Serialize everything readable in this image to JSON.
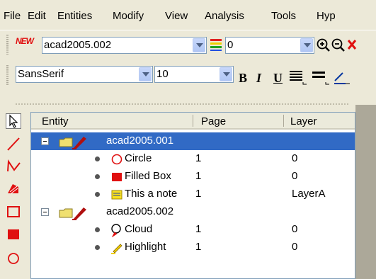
{
  "menu": {
    "items": [
      "File",
      "Edit",
      "Entities",
      "Modify",
      "View",
      "Analysis",
      "Tools",
      "Hyp"
    ]
  },
  "toolbar": {
    "new_label": "NEW",
    "document_value": "acad2005.002",
    "layer_value": "0",
    "font_value": "SansSerif",
    "size_value": "10",
    "bold_label": "B",
    "italic_label": "I",
    "underline_label": "U"
  },
  "tree": {
    "columns": [
      "Entity",
      "Page",
      "Layer"
    ],
    "rows": [
      {
        "label": "acad2005.001",
        "page": "",
        "layer": ""
      },
      {
        "label": "Circle",
        "page": "1",
        "layer": "0"
      },
      {
        "label": "Filled Box",
        "page": "1",
        "layer": "0"
      },
      {
        "label": "This a note",
        "page": "1",
        "layer": "LayerA"
      },
      {
        "label": "acad2005.002",
        "page": "",
        "layer": ""
      },
      {
        "label": "Cloud",
        "page": "1",
        "layer": "0"
      },
      {
        "label": "Highlight",
        "page": "1",
        "layer": "0"
      }
    ]
  },
  "colors": {
    "selection": "#316ac5",
    "tool_red": "#e01010",
    "window_bg": "#ece9d8"
  }
}
